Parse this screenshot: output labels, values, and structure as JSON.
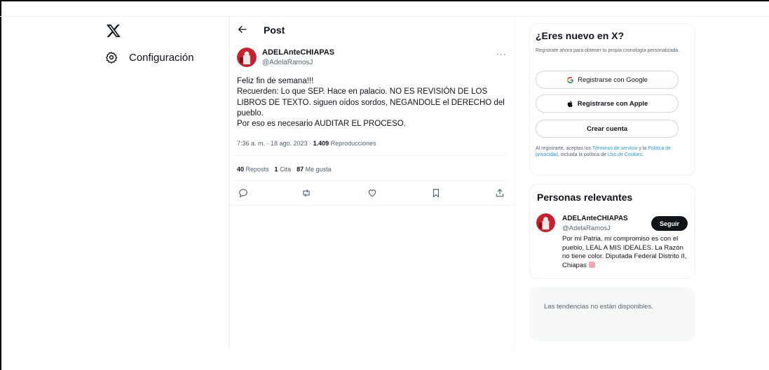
{
  "nav": {
    "settings_label": "Configuración"
  },
  "header": {
    "title": "Post"
  },
  "tweet": {
    "author_name": "ADELAnteCHIAPAS",
    "author_handle": "@AdelaRamosJ",
    "more": "···",
    "lines": [
      "Feliz fin de semana!!!",
      "Recuerden: Lo que SEP. Hace en palacio. NO ES REVISIÓN DE LOS LIBROS DE TEXTO. siguen oídos sordos, NEGANDOLE el DERECHO del pueblo.",
      "Por eso es necesario AUDITAR EL PROCESO."
    ],
    "time": "7:36 a. m. · 18 ago. 2023 · ",
    "views": "1.409",
    "views_label": " Reproducciones",
    "reposts": "40",
    "reposts_label": " Reposts",
    "quotes": "1",
    "quotes_label": " Cita",
    "likes": "87",
    "likes_label": " Me gusta"
  },
  "signup": {
    "title": "¿Eres nuevo en X?",
    "subtitle": "Regístrate ahora para obtener tu propia cronología personalizada.",
    "google": "Registrarse con Google",
    "apple": "Registrarse con Apple",
    "create": "Crear cuenta",
    "legal_1": "Al registrarte, aceptas los ",
    "terms": "Términos de servicio",
    "legal_2": " y la ",
    "privacy": "Política de privacidad",
    "legal_3": ", incluida la política de ",
    "cookies": "Uso de Cookies",
    "legal_4": "."
  },
  "people": {
    "title": "Personas relevantes",
    "name": "ADELAnteCHIAPAS",
    "handle": "@AdelaRamosJ",
    "follow": "Seguir",
    "bio": "Por mi Patria. mi compromiso es con el pueblo, LEAL A MIS IDEALES. La Razón no tiene color. Diputada Federal Distrito II, Chiapas "
  },
  "trends": {
    "message": "Las tendencias no están disponibles."
  },
  "colors": {
    "accent": "#1d9bf0",
    "text": "#0f1419",
    "muted": "#536471",
    "border": "#eff3f4"
  }
}
